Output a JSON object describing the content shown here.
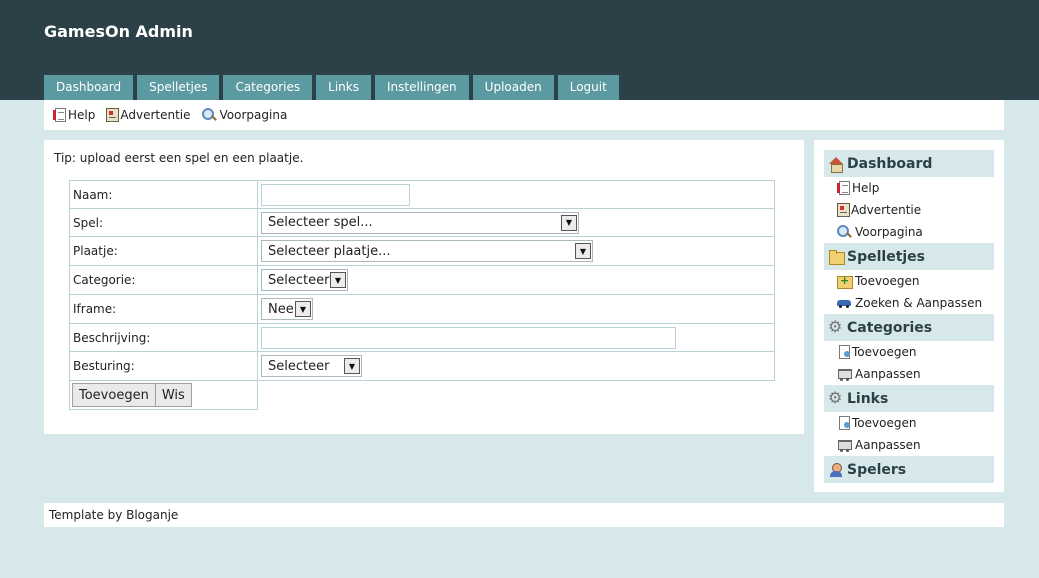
{
  "header": {
    "title": "GamesOn Admin",
    "tabs": [
      "Dashboard",
      "Spelletjes",
      "Categories",
      "Links",
      "Instellingen",
      "Uploaden",
      "Loguit"
    ]
  },
  "subnav": {
    "items": [
      {
        "label": "Help",
        "icon": "help-page-icon"
      },
      {
        "label": "Advertentie",
        "icon": "advert-icon"
      },
      {
        "label": "Voorpagina",
        "icon": "magnifier-icon"
      }
    ]
  },
  "main": {
    "tip": "Tip: upload eerst een spel en een plaatje.",
    "form": {
      "naam_label": "Naam:",
      "naam_value": "",
      "spel_label": "Spel:",
      "spel_value": "Selecteer spel...",
      "plaatje_label": "Plaatje:",
      "plaatje_value": "Selecteer plaatje...",
      "categorie_label": "Categorie:",
      "categorie_value": "Selecteer",
      "iframe_label": "Iframe:",
      "iframe_value": "Nee",
      "beschrijving_label": "Beschrijving:",
      "beschrijving_value": "",
      "besturing_label": "Besturing:",
      "besturing_value": "Selecteer",
      "add_button": "Toevoegen",
      "clear_button": "Wis"
    }
  },
  "sidebar": {
    "sections": [
      {
        "title": "Dashboard",
        "icon": "home-icon",
        "items": [
          {
            "label": "Help",
            "icon": "help-page-icon"
          },
          {
            "label": "Advertentie",
            "icon": "advert-icon"
          },
          {
            "label": "Voorpagina",
            "icon": "magnifier-icon"
          }
        ]
      },
      {
        "title": "Spelletjes",
        "icon": "folder-icon",
        "items": [
          {
            "label": "Toevoegen",
            "icon": "folder-add-icon"
          },
          {
            "label": "Zoeken & Aanpassen",
            "icon": "car-icon"
          }
        ]
      },
      {
        "title": "Categories",
        "icon": "gear-icon",
        "items": [
          {
            "label": "Toevoegen",
            "icon": "page-edit-icon"
          },
          {
            "label": "Aanpassen",
            "icon": "cart-icon"
          }
        ]
      },
      {
        "title": "Links",
        "icon": "gear-icon",
        "items": [
          {
            "label": "Toevoegen",
            "icon": "page-edit-icon"
          },
          {
            "label": "Aanpassen",
            "icon": "cart-icon"
          }
        ]
      },
      {
        "title": "Spelers",
        "icon": "user-icon",
        "items": []
      }
    ]
  },
  "footer": {
    "text": "Template by Bloganje"
  }
}
